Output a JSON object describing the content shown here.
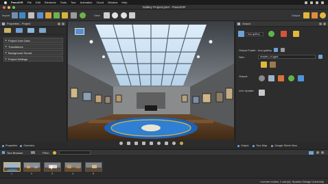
{
  "menubar": {
    "app": "Pano2VR",
    "items": [
      "File",
      "Edit",
      "Elements",
      "Tools",
      "Tour",
      "Animation",
      "Cloud",
      "Window",
      "Help"
    ]
  },
  "window": {
    "title": "Gallery Project.p2vr - Pano2VR"
  },
  "toolbar": {
    "import_label": "Import",
    "view_label": "View",
    "output_label": "Output"
  },
  "left_panel": {
    "title": "Properties - Project",
    "sections": [
      "Project User Data",
      "Translations",
      "Background Sound",
      "Project Settings"
    ]
  },
  "right_panel": {
    "title": "Output",
    "output_format": "tour gallery",
    "output_folder_label": "Output Folder:",
    "output_folder_value": "tour-gallery",
    "skin_label": "Skin:",
    "skin_value": "simplex_v4.ggsk",
    "output_label": "Output:",
    "live_update_label": "Live Update:"
  },
  "bottom_tabs_left": [
    "Properties",
    "Overview"
  ],
  "bottom_tabs_right": [
    "Output",
    "Tour Map",
    "Google Street View"
  ],
  "tour_browser": {
    "title": "Tour Browser",
    "filter_label": "Filter:",
    "thumbs": [
      "1",
      "2",
      "3",
      "4",
      "5"
    ]
  },
  "status": {
    "text": "License review, 1 user(s): Spartan Design University"
  },
  "colors": {
    "accent": "#4f94d8",
    "gold": "#e1b83c",
    "carpet": "#1c63b8"
  }
}
